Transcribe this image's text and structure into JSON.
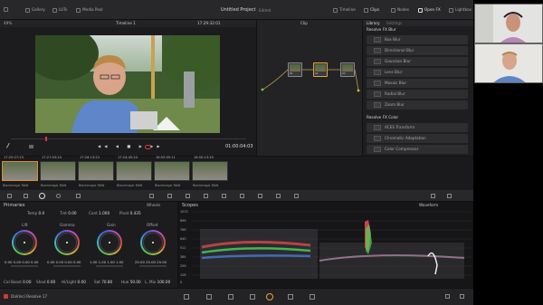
{
  "app": {
    "title": "Untitled Project",
    "edited": "Edited",
    "top_left_tabs": [
      "Gallery",
      "LUTs",
      "Media Pool"
    ],
    "top_right_tabs": [
      "Timeline",
      "Clips",
      "Nodes",
      "Open FX",
      "Lightbox"
    ],
    "timeline_name": "Timeline 1",
    "timecode_top": "17:29:32:01",
    "zoom": "49%",
    "clip_dropdown": "Clip",
    "footer_app": "DaVinci Resolve 17"
  },
  "viewer": {
    "timecode": "01:00:04:03"
  },
  "openfx": {
    "tabs": [
      "Library",
      "Settings"
    ],
    "section1": "Resolve FX Blur",
    "blur_items": [
      "Box Blur",
      "Directional Blur",
      "Gaussian Blur",
      "Lens Blur",
      "Mosaic Blur",
      "Radial Blur",
      "Zoom Blur"
    ],
    "section2": "Resolve FX Color",
    "color_items": [
      "ACES Transform",
      "Chromatic Adaptation",
      "Color Compressor"
    ]
  },
  "nodes": {
    "labels": [
      "01",
      "02",
      "03"
    ]
  },
  "clips": [
    {
      "num": "01",
      "tc": "17:29:27:23",
      "track": "V1",
      "label": "Blackmagic RAW"
    },
    {
      "num": "02",
      "tc": "17:27:03:24",
      "track": "V1",
      "label": "Blackmagic RAW"
    },
    {
      "num": "03",
      "tc": "17:26:13:23",
      "track": "V1",
      "label": "Blackmagic RAW"
    },
    {
      "num": "04",
      "tc": "17:24:45:24",
      "track": "V1",
      "label": "Blackmagic RAW"
    },
    {
      "num": "05",
      "tc": "16:55:05:11",
      "track": "V1",
      "label": "Blackmagic RAW"
    },
    {
      "num": "06",
      "tc": "16:50:13:20",
      "track": "V1",
      "label": "Blackmagic RAW"
    }
  ],
  "primaries": {
    "title": "Primaries",
    "wheels_label": "Wheels",
    "params_top": [
      {
        "label": "Temp",
        "value": "0.0"
      },
      {
        "label": "Tint",
        "value": "0.00"
      },
      {
        "label": "Cont",
        "value": "1.000"
      },
      {
        "label": "Pivot",
        "value": "0.435"
      }
    ],
    "wheels": [
      {
        "name": "Lift",
        "values": "0.00  0.00  0.00  0.00"
      },
      {
        "name": "Gamma",
        "values": "0.00  0.00  0.00  0.00"
      },
      {
        "name": "Gain",
        "values": "1.00  1.00  1.00  1.00"
      },
      {
        "name": "Offset",
        "values": "25.00  25.00  25.00"
      }
    ],
    "params_bottom": [
      {
        "label": "Col Boost",
        "value": "0.00"
      },
      {
        "label": "Shad",
        "value": "0.00"
      },
      {
        "label": "Hi/Light",
        "value": "0.00"
      },
      {
        "label": "Sat",
        "value": "70.80"
      },
      {
        "label": "Hue",
        "value": "50.00"
      },
      {
        "label": "L. Mix",
        "value": "100.00"
      }
    ]
  },
  "scopes": {
    "title": "Scopes",
    "mode": "Waveform",
    "scale": [
      "1023",
      "896",
      "768",
      "640",
      "512",
      "384",
      "256",
      "128",
      "0"
    ]
  },
  "colors": {
    "accent": "#e6a23c",
    "panel": "#1c1c1e",
    "bar": "#28282b",
    "playhead": "#d63b3b"
  }
}
